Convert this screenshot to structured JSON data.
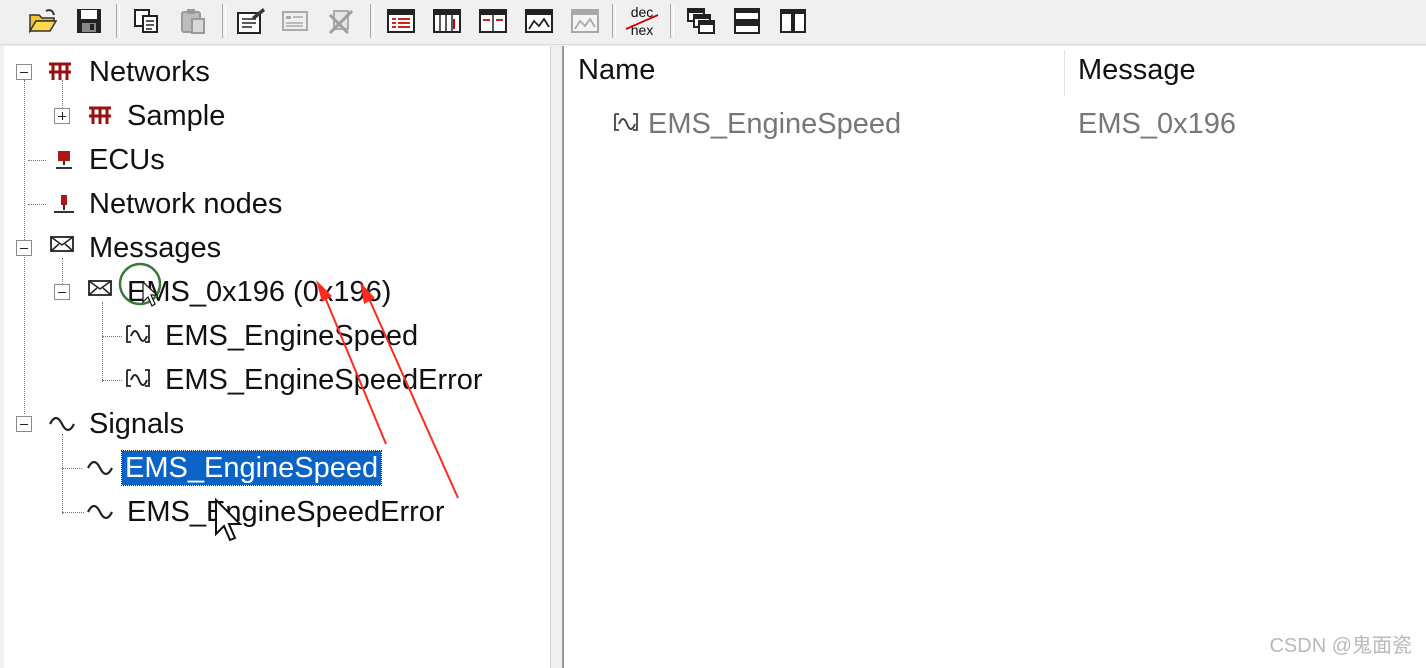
{
  "toolbar": {
    "buttons": [
      "open-icon",
      "save-icon",
      "copy-icon",
      "paste-icon",
      "edit-icon",
      "properties-icon",
      "delete-icon",
      "table-view-1-icon",
      "table-view-2-icon",
      "table-view-3-icon",
      "chart-view-icon",
      "chart-view-disabled-icon",
      "dec-hex-icon",
      "cascade-windows-icon",
      "tile-horizontal-icon",
      "tile-vertical-icon"
    ],
    "dec_hex": {
      "top": "dec",
      "bottom": "hex"
    }
  },
  "tree": {
    "networks": "Networks",
    "sample": "Sample",
    "ecus": "ECUs",
    "network_nodes": "Network nodes",
    "messages": "Messages",
    "message_item": "EMS_0x196 (0x196)",
    "msg_signal_1": "EMS_EngineSpeed",
    "msg_signal_2": "EMS_EngineSpeedError",
    "signals": "Signals",
    "signal_1": "EMS_EngineSpeed",
    "signal_2": "EMS_EngineSpeedError"
  },
  "list": {
    "headers": {
      "name": "Name",
      "message": "Message"
    },
    "rows": [
      {
        "name": "EMS_EngineSpeed",
        "message": "EMS_0x196"
      }
    ]
  },
  "colors": {
    "selection": "#0a64c8",
    "annotation": "#ff2a1f"
  },
  "watermark": "CSDN @鬼面瓷"
}
